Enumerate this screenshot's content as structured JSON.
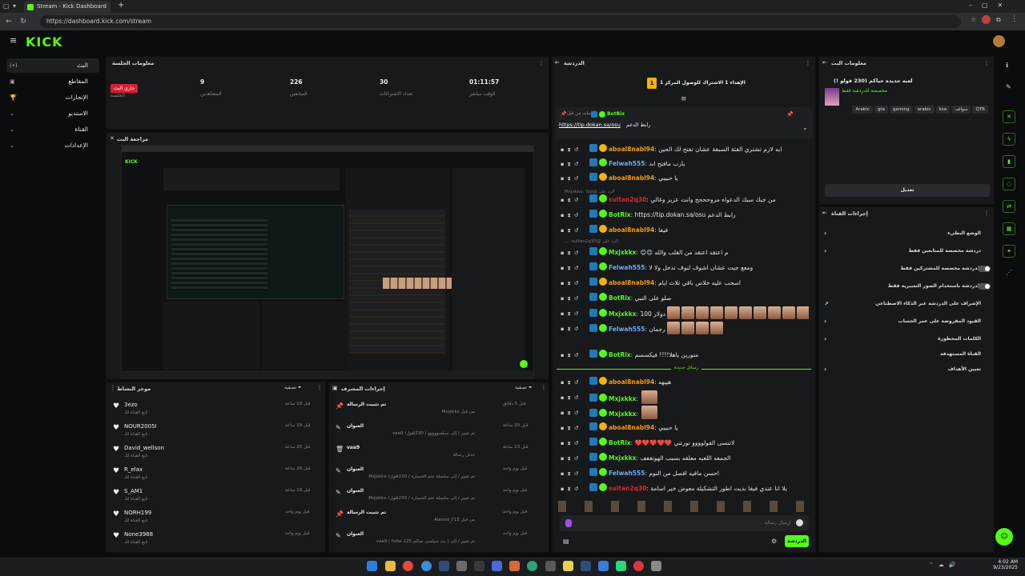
{
  "browser": {
    "tab_title": "Stream - Kick Dashboard",
    "url": "https://dashboard.kick.com/stream",
    "new_tab": "+"
  },
  "logo": "KICK",
  "nav": [
    {
      "label": "البث",
      "icon": "(•)"
    },
    {
      "label": "المقاطع",
      "icon": "▣"
    },
    {
      "label": "الإنجازات",
      "icon": "🏆"
    },
    {
      "label": "الاستديو",
      "icon": "⌄"
    },
    {
      "label": "القناة",
      "icon": "⌄"
    },
    {
      "label": "الإعدادات",
      "icon": "⌄"
    }
  ],
  "session": {
    "title": "معلومات الجلسة",
    "badge": "جاري البث",
    "badge_label": "الجلسة",
    "stats": [
      {
        "value": "9",
        "label": "المشاهدين"
      },
      {
        "value": "226",
        "label": "المتابعين"
      },
      {
        "value": "30",
        "label": "تعداد الاشتراكات"
      },
      {
        "value": "01:11:57",
        "label": "الوقت مباشر"
      }
    ]
  },
  "preview": {
    "title": "مراجعة البث"
  },
  "chat": {
    "title": "الدردشة",
    "goal": "الإهداء 1 الاشتراك للوصول المركز 1",
    "goal_rank": "1",
    "pinned_by": "أرسلت من قبل",
    "pinned_user": "BotRix",
    "pinned_text": "رابط الدعم",
    "pinned_link": "https://tip.dokan.sa/osu",
    "new_messages": "رسائل جديدة",
    "input_placeholder": "إرسال رسالة",
    "send_label": "الدردشة",
    "reply1": "الرد على @Mxjxkkx: !bp",
    "reply2": "الرد على @sultan2q30: ...",
    "messages": [
      {
        "user": "aboal8nabl94",
        "color": "#f39c12",
        "text": "ايه لازم تشتري الفئة السبقة عشان تفتح لك الحين"
      },
      {
        "user": "Felwah555",
        "color": "#6fa8ff",
        "text": "يارب مافتح ابد"
      },
      {
        "user": "aboal8nabl94",
        "color": "#f39c12",
        "text": "يا حبيبي"
      },
      {
        "user": "sultan2q30",
        "color": "#e6222b",
        "text": "من جبك سبك الدعواه مزوحححح وانت عزيز وغالي"
      },
      {
        "user": "BotRix",
        "color": "#53fc18",
        "text": "رابط الدعم https://tip.dokan.sa/osu"
      },
      {
        "user": "aboal8nabl94",
        "color": "#f39c12",
        "text": "فيفا"
      },
      {
        "user": "Mxjxkkx",
        "color": "#53fc18",
        "text": "م اعتقد اعتقد من القلب والله 😊😊"
      },
      {
        "user": "Felwah555",
        "color": "#6fa8ff",
        "text": "ومعع جيت عشان اشوف لنوف تدخل ولا لا"
      },
      {
        "user": "aboal8nabl94",
        "color": "#f39c12",
        "text": "اسحب عليه خلاص باقي ثلاث ايام"
      },
      {
        "user": "BotRix",
        "color": "#53fc18",
        "text": "صلو على النبي"
      },
      {
        "user": "Mxjxkkx",
        "color": "#53fc18",
        "text": "دولار 100"
      },
      {
        "user": "Felwah555",
        "color": "#6fa8ff",
        "text": "رجمان"
      },
      {
        "user": "BotRix",
        "color": "#53fc18",
        "text": "متورين ياهلا!!!! فيكسسم"
      },
      {
        "user": "aboal8nabl94",
        "color": "#f39c12",
        "text": "هييهه"
      },
      {
        "user": "Mxjxkkx",
        "color": "#53fc18",
        "text": ""
      },
      {
        "user": "Mxjxkkx",
        "color": "#53fc18",
        "text": ""
      },
      {
        "user": "aboal8nabl94",
        "color": "#f39c12",
        "text": "يا حبيبي"
      },
      {
        "user": "BotRix",
        "color": "#53fc18",
        "text": "لاتنسى الفولوووو نورتني ❤️❤️❤️❤️❤️"
      },
      {
        "user": "Mxjxkkx",
        "color": "#53fc18",
        "text": "الجمعه اللعبه معلقه بسبب الهوتففف"
      },
      {
        "user": "Felwah555",
        "color": "#6fa8ff",
        "text": "احسن مافيه افصل من النوم"
      },
      {
        "user": "sultan2q30",
        "color": "#e6222b",
        "text": "يلا انا عندي فيفا بديت اطور التشكيلة معوض خير اسامة"
      }
    ]
  },
  "supporters": {
    "title": "موجز النشاط",
    "filter": "تصفية",
    "rows": [
      {
        "name": "3ezo",
        "sub": "تابع القناة لك",
        "time": "قبل 19 ساعة"
      },
      {
        "name": "NOUR2005I",
        "sub": "تابع القناة لك",
        "time": "قبل 19 ساعة"
      },
      {
        "name": "David_wellson",
        "sub": "تابع القناة لك",
        "time": "قبل 20 ساعة"
      },
      {
        "name": "R_elax",
        "sub": "تابع القناة لك",
        "time": "قبل 20 ساعة"
      },
      {
        "name": "S_AM1",
        "sub": "تابع القناة لك",
        "time": "قبل 19 ساعة"
      },
      {
        "name": "NORH199",
        "sub": "تابع القناة لك",
        "time": "قبل يوم واحد"
      },
      {
        "name": "None3988",
        "sub": "تابع القناة لك",
        "time": "قبل يوم واحد"
      }
    ]
  },
  "modactions": {
    "title": "إجراءات المشرف",
    "filter": "تصفية",
    "rows": [
      {
        "title": "تم تثبيت الرسالة",
        "sub": "من قبل Mxjxkkx",
        "time": "قبل 5 دقائق"
      },
      {
        "title": "العنوان",
        "sub": "تم تغيير / إلى سيلمبووووو / 230افول! vaa9",
        "time": "قبل 20 ساعة"
      },
      {
        "title": "vaa9",
        "sub": "حذف رسالة",
        "time": "قبل 23 ساعة"
      },
      {
        "title": "العنوان",
        "sub": "تم تغيير / إلى سلسلة ختم الخسارة / 230افول! Mxjxkkx",
        "time": "قبل يوم واحد"
      },
      {
        "title": "العنوان",
        "sub": "تم تغيير / إلى سلسلة ختم الخسارة / 230افول! Mxjxkkx",
        "time": "قبل يوم واحد"
      },
      {
        "title": "تم تثبيت الرسالة",
        "sub": "من قبل Alanod_F15",
        "time": "قبل يوم واحد"
      },
      {
        "title": "العنوان",
        "sub": "تم تغيير / إلى ( بث سيلمبى حياكم 225 follw ) vaa9",
        "time": "قبل يوم واحد"
      }
    ]
  },
  "streaminfo": {
    "title": "معلومات البث",
    "stream_title": "لعبه جديده حياكم (230 فولو !)",
    "category": "مخصصة للدردشة فقط",
    "tags": [
      "QTR",
      "سوالف",
      "ksa",
      "arabic",
      "gaming",
      "gta",
      "Arabic"
    ],
    "edit_button": "تعديل"
  },
  "channelactions": {
    "title": "إجراءات القناة",
    "items": [
      {
        "label": "الوضع البطيء",
        "kind": "chevron"
      },
      {
        "label": "دردشة مخصصة للمتابعين فقط",
        "kind": "chevron"
      },
      {
        "label": "الدردشة مخصصة للمشتركين فقط",
        "kind": "toggle"
      },
      {
        "label": "الدردشة باستخدام الصور التعبيرية فقط",
        "kind": "toggle"
      },
      {
        "label": "الإشراف على الدردشة عبر الذكاء الاصطناعي",
        "kind": "ext"
      },
      {
        "label": "القيود المفروضة على عمر الحساب",
        "kind": "chevron"
      },
      {
        "label": "الكلمات المحظورة",
        "kind": "chevron"
      },
      {
        "label": "القناة المستهدفة",
        "kind": "none"
      },
      {
        "label": "تعيين الأهداف",
        "kind": "chevron"
      }
    ]
  },
  "clock": {
    "time": "4:02 AM",
    "date": "9/23/2025"
  }
}
